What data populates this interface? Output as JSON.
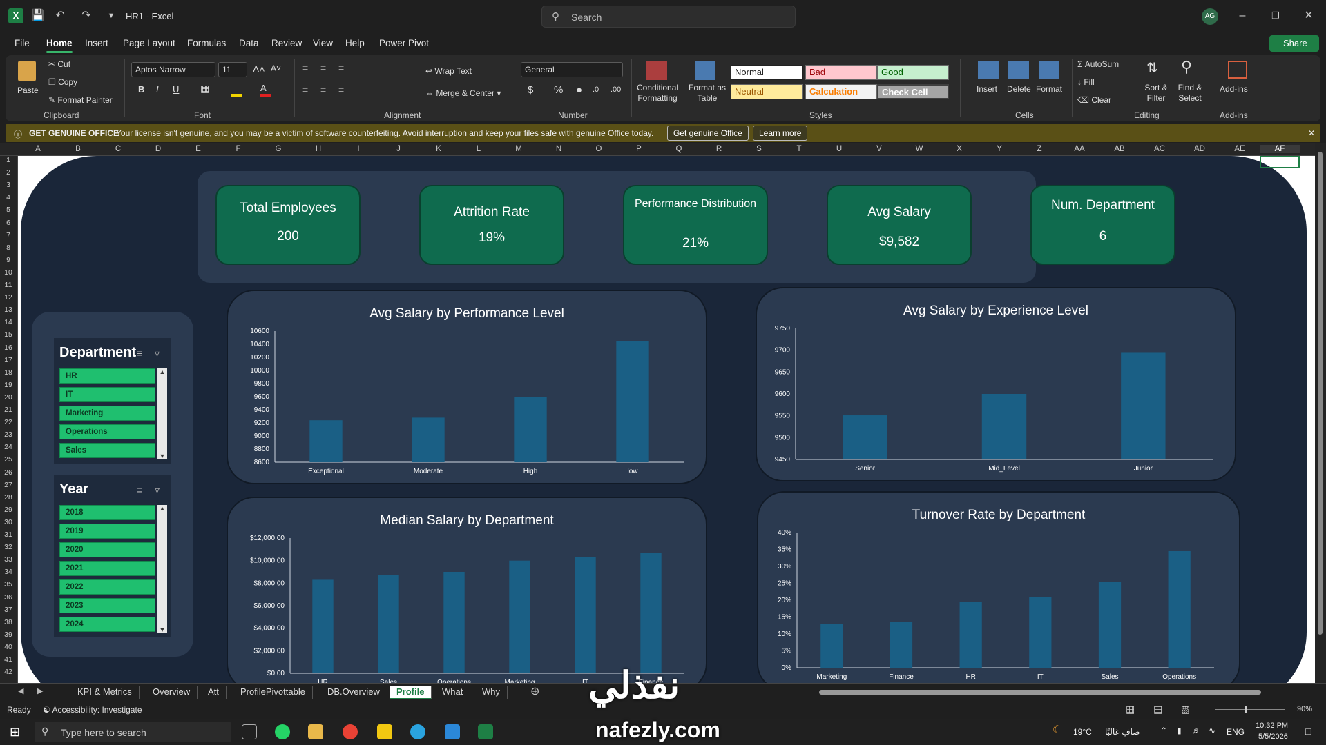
{
  "window": {
    "title": "HR1 - Excel",
    "search_placeholder": "Search",
    "avatar": "AG"
  },
  "menu": [
    "File",
    "Home",
    "Insert",
    "Page Layout",
    "Formulas",
    "Data",
    "Review",
    "View",
    "Help",
    "Power Pivot"
  ],
  "share_label": "Share",
  "ribbon": {
    "clipboard": {
      "paste": "Paste",
      "cut": "Cut",
      "copy": "Copy",
      "format_painter": "Format Painter",
      "group": "Clipboard"
    },
    "font": {
      "name": "Aptos Narrow",
      "size": "11",
      "group": "Font"
    },
    "alignment": {
      "wrap": "Wrap Text",
      "merge": "Merge & Center",
      "group": "Alignment"
    },
    "number": {
      "format": "General",
      "group": "Number"
    },
    "styles": {
      "conditional": "Conditional Formatting",
      "format_table": "Format as Table",
      "normal": "Normal",
      "bad": "Bad",
      "good": "Good",
      "neutral": "Neutral",
      "calculation": "Calculation",
      "check_cell": "Check Cell",
      "group": "Styles"
    },
    "cells": {
      "insert": "Insert",
      "delete": "Delete",
      "format": "Format",
      "group": "Cells"
    },
    "editing": {
      "autosum": "AutoSum",
      "fill": "Fill",
      "clear": "Clear",
      "sort": "Sort & Filter",
      "find": "Find & Select",
      "group": "Editing"
    },
    "addins": {
      "label": "Add-ins",
      "group": "Add-ins"
    }
  },
  "banner": {
    "title": "GET GENUINE OFFICE",
    "message": "Your license isn't genuine, and you may be a victim of software counterfeiting. Avoid interruption and keep your files safe with genuine Office today.",
    "btn_genuine": "Get genuine Office",
    "btn_learn": "Learn more"
  },
  "columns": [
    "A",
    "B",
    "C",
    "D",
    "E",
    "F",
    "G",
    "H",
    "I",
    "J",
    "K",
    "L",
    "M",
    "N",
    "O",
    "P",
    "Q",
    "R",
    "S",
    "T",
    "U",
    "V",
    "W",
    "X",
    "Y",
    "Z",
    "AA",
    "AB",
    "AC",
    "AD",
    "AE",
    "AF"
  ],
  "rows": [
    "1",
    "2",
    "3",
    "4",
    "5",
    "6",
    "7",
    "8",
    "9",
    "10",
    "11",
    "12",
    "13",
    "14",
    "15",
    "16",
    "17",
    "18",
    "19",
    "20",
    "21",
    "22",
    "23",
    "24",
    "25",
    "26",
    "27",
    "28",
    "29",
    "30",
    "31",
    "32",
    "33",
    "34",
    "35",
    "36",
    "37",
    "38",
    "39",
    "40",
    "41",
    "42"
  ],
  "kpis": [
    {
      "label": "Total Employees",
      "value": "200"
    },
    {
      "label": "Attrition Rate",
      "value": "19%"
    },
    {
      "label": "Performance Distribution",
      "value": "21%"
    },
    {
      "label": "Avg Salary",
      "value": "$9,582"
    },
    {
      "label": "Num. Department",
      "value": "6"
    }
  ],
  "slicers": {
    "department": {
      "title": "Department",
      "items": [
        "HR",
        "IT",
        "Marketing",
        "Operations",
        "Sales"
      ]
    },
    "year": {
      "title": "Year",
      "items": [
        "2018",
        "2019",
        "2020",
        "2021",
        "2022",
        "2023",
        "2024"
      ]
    }
  },
  "chart_data": [
    {
      "type": "bar",
      "title": "Avg Salary by Performance Level",
      "categories": [
        "Exceptional",
        "Moderate",
        "High",
        "low"
      ],
      "values": [
        9240,
        9280,
        9600,
        10450
      ],
      "ylim": [
        8600,
        10600
      ],
      "yticks": [
        "8600",
        "8800",
        "9000",
        "9200",
        "9400",
        "9600",
        "9800",
        "10000",
        "10200",
        "10400",
        "10600"
      ],
      "color": "#1a5f85"
    },
    {
      "type": "bar",
      "title": "Avg Salary by Experience Level",
      "categories": [
        "Senior",
        "Mid_Level",
        "Junior"
      ],
      "values": [
        9551,
        9600,
        9694
      ],
      "ylim": [
        9450,
        9750
      ],
      "yticks": [
        "9450",
        "9500",
        "9550",
        "9600",
        "9650",
        "9700",
        "9750"
      ],
      "color": "#1a5f85"
    },
    {
      "type": "bar",
      "title": "Median Salary by Department",
      "categories": [
        "HR",
        "Sales",
        "Operations",
        "Marketing",
        "IT",
        "Finance"
      ],
      "values": [
        8300,
        8700,
        9000,
        10000,
        10300,
        10700
      ],
      "ylim": [
        0,
        12000
      ],
      "yticks": [
        "$0.00",
        "$2,000.00",
        "$4,000.00",
        "$6,000.00",
        "$8,000.00",
        "$10,000.00",
        "$12,000.00"
      ],
      "color": "#1a5f85"
    },
    {
      "type": "bar",
      "title": "Turnover Rate by Department",
      "categories": [
        "Marketing",
        "Finance",
        "HR",
        "IT",
        "Sales",
        "Operations"
      ],
      "values": [
        13,
        13.5,
        19.5,
        21,
        25.5,
        34.5
      ],
      "ylim": [
        0,
        40
      ],
      "yticks": [
        "0%",
        "5%",
        "10%",
        "15%",
        "20%",
        "25%",
        "30%",
        "35%",
        "40%"
      ],
      "color": "#1a5f85"
    }
  ],
  "sheet_tabs": [
    "KPI & Metrics",
    "Overview",
    "Att",
    "ProfilePivottable",
    "DB.Overview",
    "Profile",
    "What",
    "Why"
  ],
  "active_tab": "Profile",
  "status": {
    "ready": "Ready",
    "accessibility": "Accessibility: Investigate",
    "zoom": "90%"
  },
  "taskbar": {
    "search": "Type here to search",
    "weather": "19°C",
    "weather_text": "صافٍ غالبًا",
    "lang": "ENG",
    "time": "10:32 PM",
    "date": "5/5/2026"
  },
  "watermark": {
    "arabic": "نفذلي",
    "latin": "nafezly.com"
  }
}
